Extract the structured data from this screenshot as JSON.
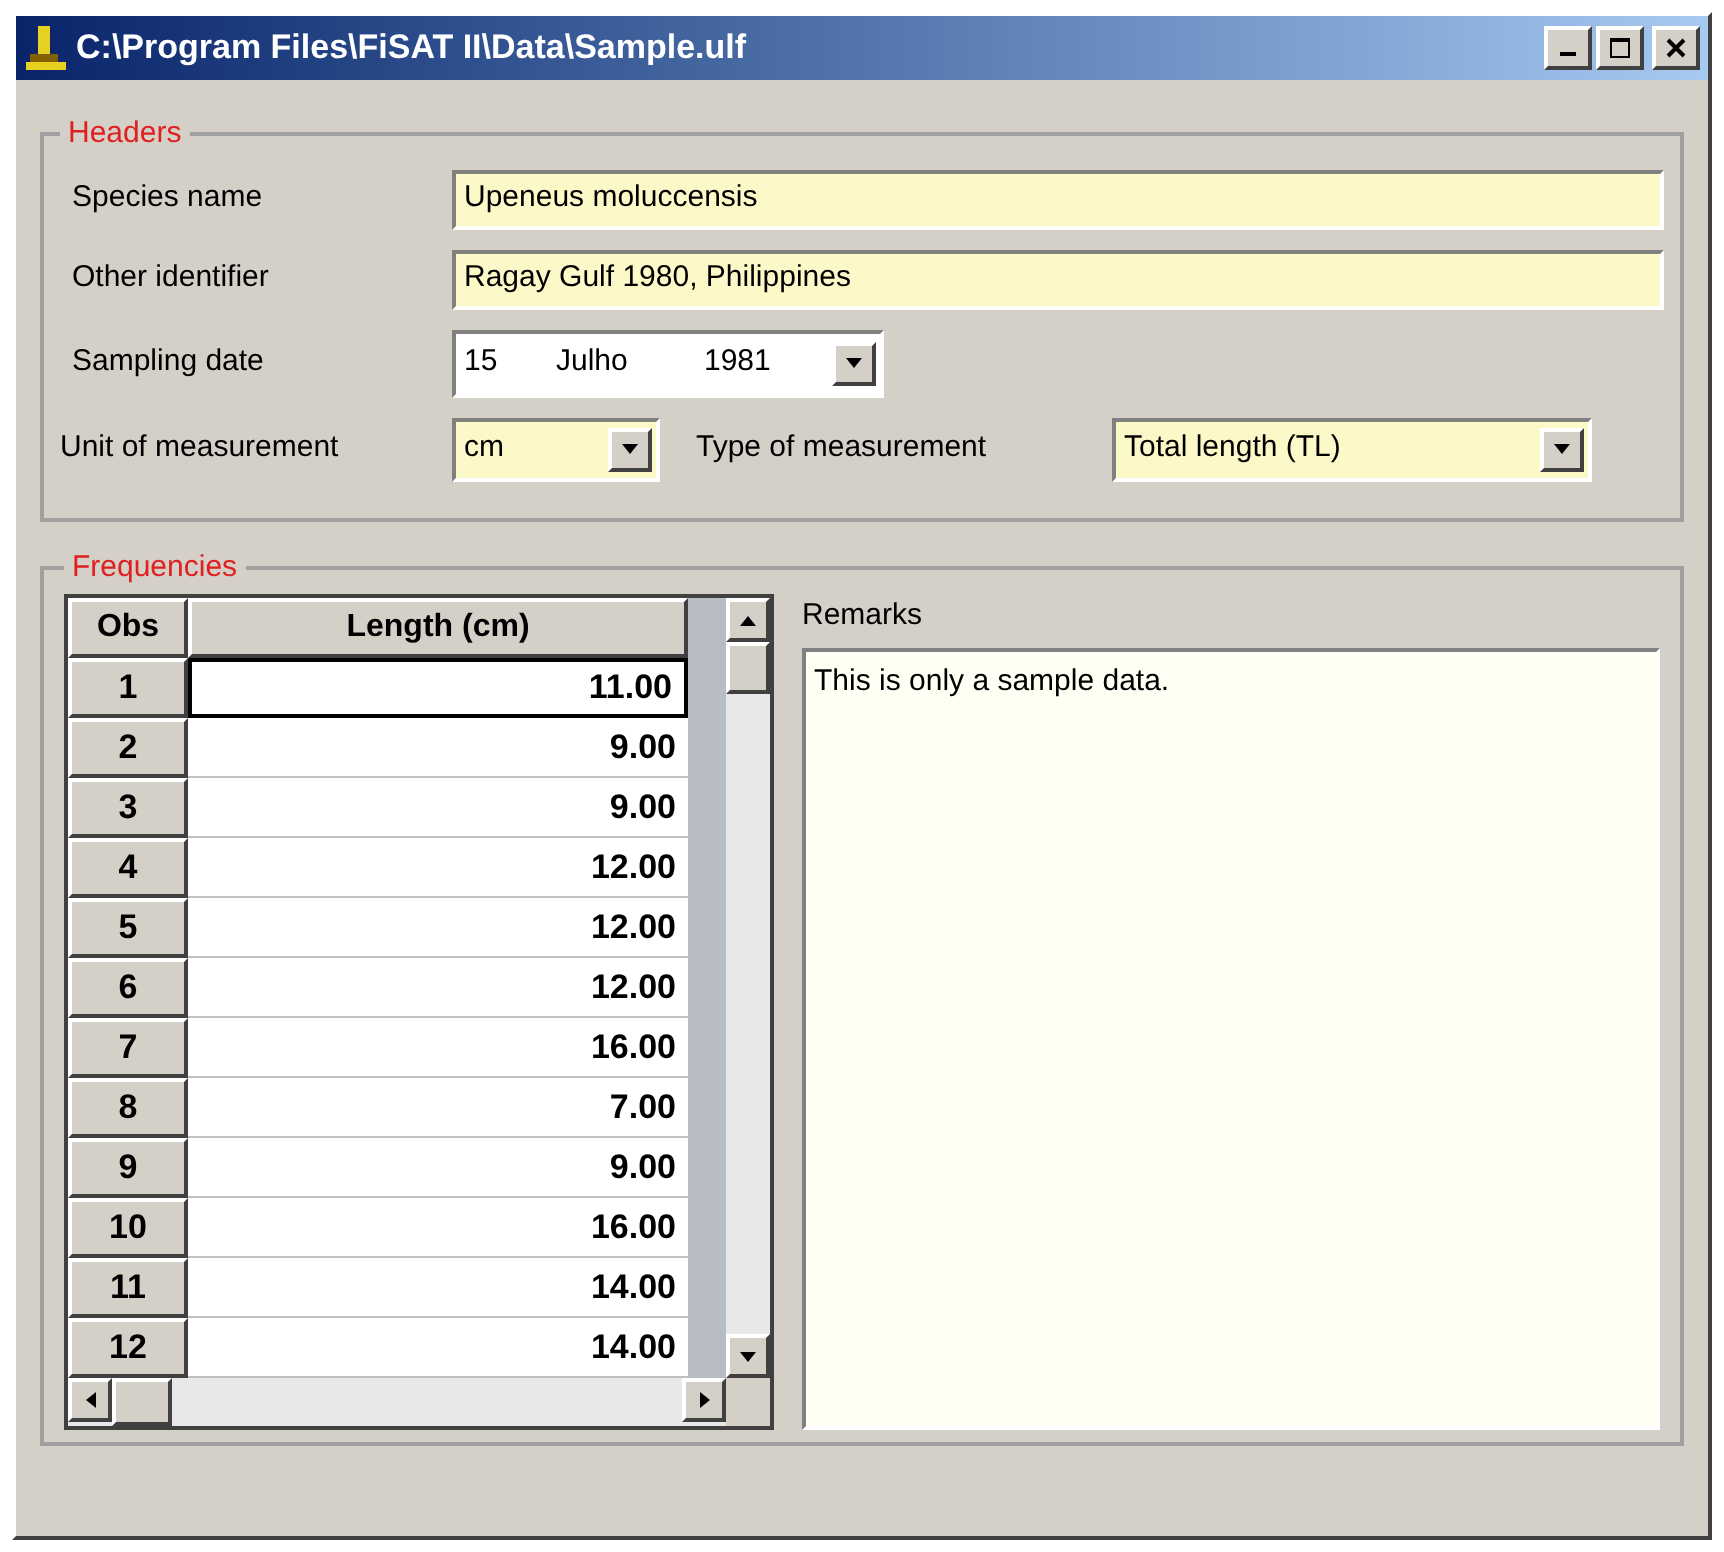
{
  "window": {
    "title": "C:\\Program Files\\FiSAT II\\Data\\Sample.ulf"
  },
  "headers": {
    "title": "Headers",
    "species_name": {
      "label": "Species name",
      "value": "Upeneus moluccensis"
    },
    "other_identifier": {
      "label": "Other identifier",
      "value": "Ragay Gulf 1980, Philippines"
    },
    "sampling_date": {
      "label": "Sampling date",
      "day": "15",
      "month": "Julho",
      "year": "1981"
    },
    "unit": {
      "label": "Unit of measurement",
      "value": "cm"
    },
    "type": {
      "label": "Type of measurement",
      "value": "Total length (TL)"
    }
  },
  "frequencies": {
    "title": "Frequencies",
    "table": {
      "columns": [
        "Obs",
        "Length (cm)"
      ],
      "rows": [
        {
          "obs": "1",
          "length": "11.00",
          "selected": true
        },
        {
          "obs": "2",
          "length": "9.00",
          "selected": false
        },
        {
          "obs": "3",
          "length": "9.00",
          "selected": false
        },
        {
          "obs": "4",
          "length": "12.00",
          "selected": false
        },
        {
          "obs": "5",
          "length": "12.00",
          "selected": false
        },
        {
          "obs": "6",
          "length": "12.00",
          "selected": false
        },
        {
          "obs": "7",
          "length": "16.00",
          "selected": false
        },
        {
          "obs": "8",
          "length": "7.00",
          "selected": false
        },
        {
          "obs": "9",
          "length": "9.00",
          "selected": false
        },
        {
          "obs": "10",
          "length": "16.00",
          "selected": false
        },
        {
          "obs": "11",
          "length": "14.00",
          "selected": false
        },
        {
          "obs": "12",
          "length": "14.00",
          "selected": false
        }
      ]
    },
    "remarks": {
      "label": "Remarks",
      "value": "This is only a sample data."
    }
  }
}
